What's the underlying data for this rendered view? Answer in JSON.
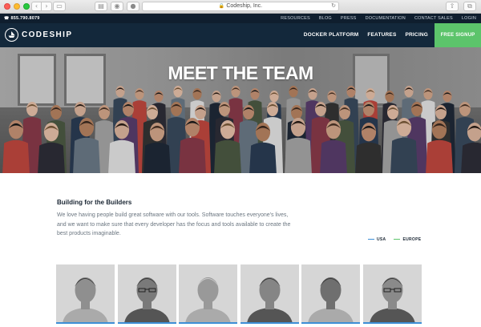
{
  "browser": {
    "url": "Codeship, Inc.",
    "back_glyph": "‹",
    "forward_glyph": "›",
    "sidebar_glyph": "▭",
    "ext1_glyph": "▤",
    "ext2_glyph": "◉",
    "ext3_glyph": "●",
    "reload_glyph": "↻",
    "share_glyph": "⇧",
    "tabs_glyph": "⧉",
    "newtab_glyph": "+"
  },
  "utility_bar": {
    "phone": "855.790.8079",
    "links": [
      "RESOURCES",
      "BLOG",
      "PRESS",
      "DOCUMENTATION",
      "CONTACT SALES",
      "LOGIN"
    ]
  },
  "nav": {
    "logo_text": "CODESHIP",
    "links": [
      "DOCKER PLATFORM",
      "FEATURES",
      "PRICING"
    ],
    "signup": "FREE SIGNUP"
  },
  "hero": {
    "title": "MEET THE TEAM"
  },
  "content": {
    "title": "Building for the Builders",
    "body": "We love having people build great software with our tools. Software touches everyone's lives, and we want to make sure that every developer has the focus and tools available to create the best products imaginable."
  },
  "legend": [
    {
      "label": "USA",
      "color": "#3d8fd6"
    },
    {
      "label": "EUROPE",
      "color": "#5cc46b"
    }
  ],
  "colors": {
    "accent": "#5cc46b",
    "nav_bg": "#13283b",
    "util_bg": "#0f1e2e"
  }
}
